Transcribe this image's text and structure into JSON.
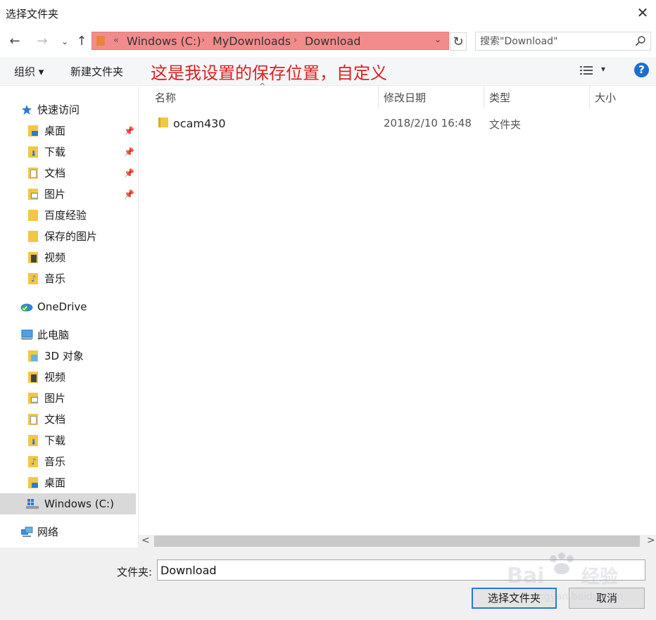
{
  "window": {
    "title": "选择文件夹",
    "close_glyph": "✕"
  },
  "nav": {
    "back_glyph": "←",
    "forward_glyph": "→",
    "recent_glyph": "⌄",
    "up_glyph": "↑",
    "refresh_glyph": "↻"
  },
  "address": {
    "overflow": "«",
    "crumbs": [
      "Windows (C:)",
      "MyDownloads",
      "Download"
    ],
    "separator": "›",
    "dropdown_glyph": "⌄",
    "highlight_color": "#f28c8c"
  },
  "search": {
    "placeholder": "搜索\"Download\""
  },
  "toolbar": {
    "organize_label": "组织 ▾",
    "new_folder_label": "新建文件夹",
    "view_caret": "▾",
    "help_glyph": "?"
  },
  "annotation": {
    "text": "这是我设置的保存位置，自定义",
    "color": "#e02020"
  },
  "sidebar": {
    "quick_access": {
      "label": "快速访问",
      "icon": "star-icon"
    },
    "quick_items": [
      {
        "label": "桌面",
        "icon": "desktop-folder-icon",
        "pinned": true
      },
      {
        "label": "下载",
        "icon": "downloads-folder-icon",
        "pinned": true
      },
      {
        "label": "文档",
        "icon": "documents-folder-icon",
        "pinned": true
      },
      {
        "label": "图片",
        "icon": "pictures-folder-icon",
        "pinned": true
      },
      {
        "label": "百度经验",
        "icon": "folder-icon",
        "pinned": false
      },
      {
        "label": "保存的图片",
        "icon": "folder-icon",
        "pinned": false
      },
      {
        "label": "视频",
        "icon": "videos-folder-icon",
        "pinned": false
      },
      {
        "label": "音乐",
        "icon": "music-folder-icon",
        "pinned": false
      }
    ],
    "onedrive": {
      "label": "OneDrive",
      "icon": "onedrive-icon"
    },
    "this_pc": {
      "label": "此电脑",
      "icon": "computer-icon"
    },
    "pc_items": [
      {
        "label": "3D 对象",
        "icon": "3d-objects-folder-icon"
      },
      {
        "label": "视频",
        "icon": "videos-folder-icon"
      },
      {
        "label": "图片",
        "icon": "pictures-folder-icon"
      },
      {
        "label": "文档",
        "icon": "documents-folder-icon"
      },
      {
        "label": "下载",
        "icon": "downloads-folder-icon"
      },
      {
        "label": "音乐",
        "icon": "music-folder-icon"
      },
      {
        "label": "桌面",
        "icon": "desktop-folder-icon"
      },
      {
        "label": "Windows (C:)",
        "icon": "drive-icon",
        "selected": true
      }
    ],
    "network": {
      "label": "网络",
      "icon": "network-icon"
    },
    "pin_glyph": "📌"
  },
  "list": {
    "columns": [
      "名称",
      "修改日期",
      "类型",
      "大小"
    ],
    "sort_glyph": "^",
    "rows": [
      {
        "name": "ocam430",
        "modified": "2018/2/10 16:48",
        "type": "文件夹",
        "size": ""
      }
    ]
  },
  "scroll": {
    "left_glyph": "<",
    "right_glyph": ">"
  },
  "bottom": {
    "folder_label": "文件夹:",
    "folder_value": "Download",
    "select_button": "选择文件夹",
    "cancel_button": "取消"
  },
  "colors": {
    "folder_yellow": "#f2c744",
    "accent_blue": "#2b79d8",
    "selected_bg": "#d9d9d9"
  }
}
